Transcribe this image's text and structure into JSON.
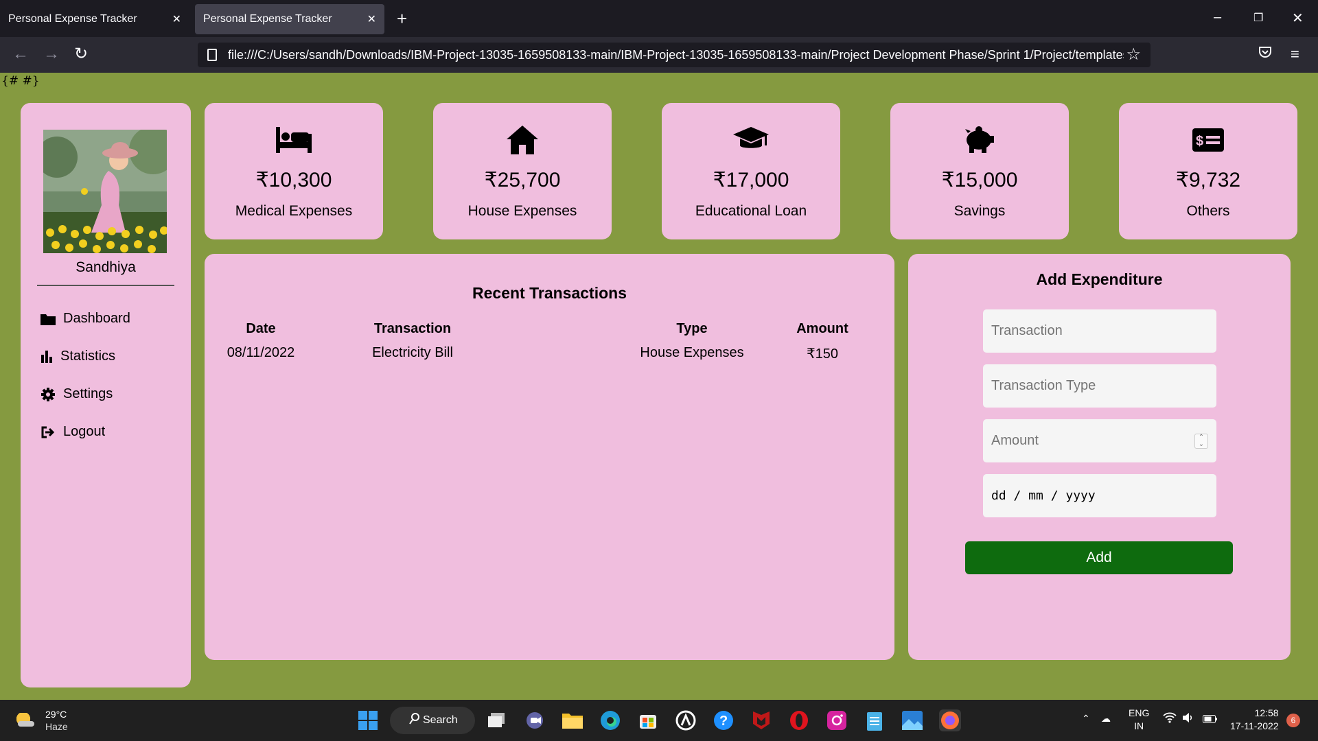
{
  "browser": {
    "tabs": [
      {
        "title": "Personal Expense Tracker"
      },
      {
        "title": "Personal Expense Tracker"
      }
    ],
    "url": "file:///C:/Users/sandh/Downloads/IBM-Project-13035-1659508133-main/IBM-Project-13035-1659508133-main/Project Development Phase/Sprint 1/Project/templates/hom"
  },
  "template_text": "{# #}",
  "sidebar": {
    "username": "Sandhiya",
    "items": [
      {
        "label": "Dashboard",
        "icon": "folder-icon"
      },
      {
        "label": "Statistics",
        "icon": "bar-chart-icon"
      },
      {
        "label": "Settings",
        "icon": "gear-icon"
      },
      {
        "label": "Logout",
        "icon": "logout-icon"
      }
    ]
  },
  "stats": [
    {
      "amount": "₹10,300",
      "label": "Medical Expenses",
      "icon": "bed-icon"
    },
    {
      "amount": "₹25,700",
      "label": "House Expenses",
      "icon": "home-icon"
    },
    {
      "amount": "₹17,000",
      "label": "Educational Loan",
      "icon": "graduation-cap-icon"
    },
    {
      "amount": "₹15,000",
      "label": "Savings",
      "icon": "piggy-bank-icon"
    },
    {
      "amount": "₹9,732",
      "label": "Others",
      "icon": "money-check-icon"
    }
  ],
  "recent": {
    "title": "Recent Transactions",
    "headers": [
      "Date",
      "Transaction",
      "Type",
      "Amount"
    ],
    "rows": [
      [
        "08/11/2022",
        "Electricity Bill",
        "House Expenses",
        "₹150"
      ]
    ]
  },
  "form": {
    "title": "Add Expenditure",
    "transaction_placeholder": "Transaction",
    "type_placeholder": "Transaction Type",
    "amount_placeholder": "Amount",
    "date_placeholder": "dd / mm / yyyy",
    "add_label": "Add"
  },
  "taskbar": {
    "temp": "29°C",
    "weather": "Haze",
    "search": "Search",
    "lang1": "ENG",
    "lang2": "IN",
    "time": "12:58",
    "date": "17-11-2022",
    "notifications": "6"
  },
  "colors": {
    "page_bg": "#859a40",
    "card_bg": "#f0bede",
    "add_button": "#0e6b0e"
  }
}
